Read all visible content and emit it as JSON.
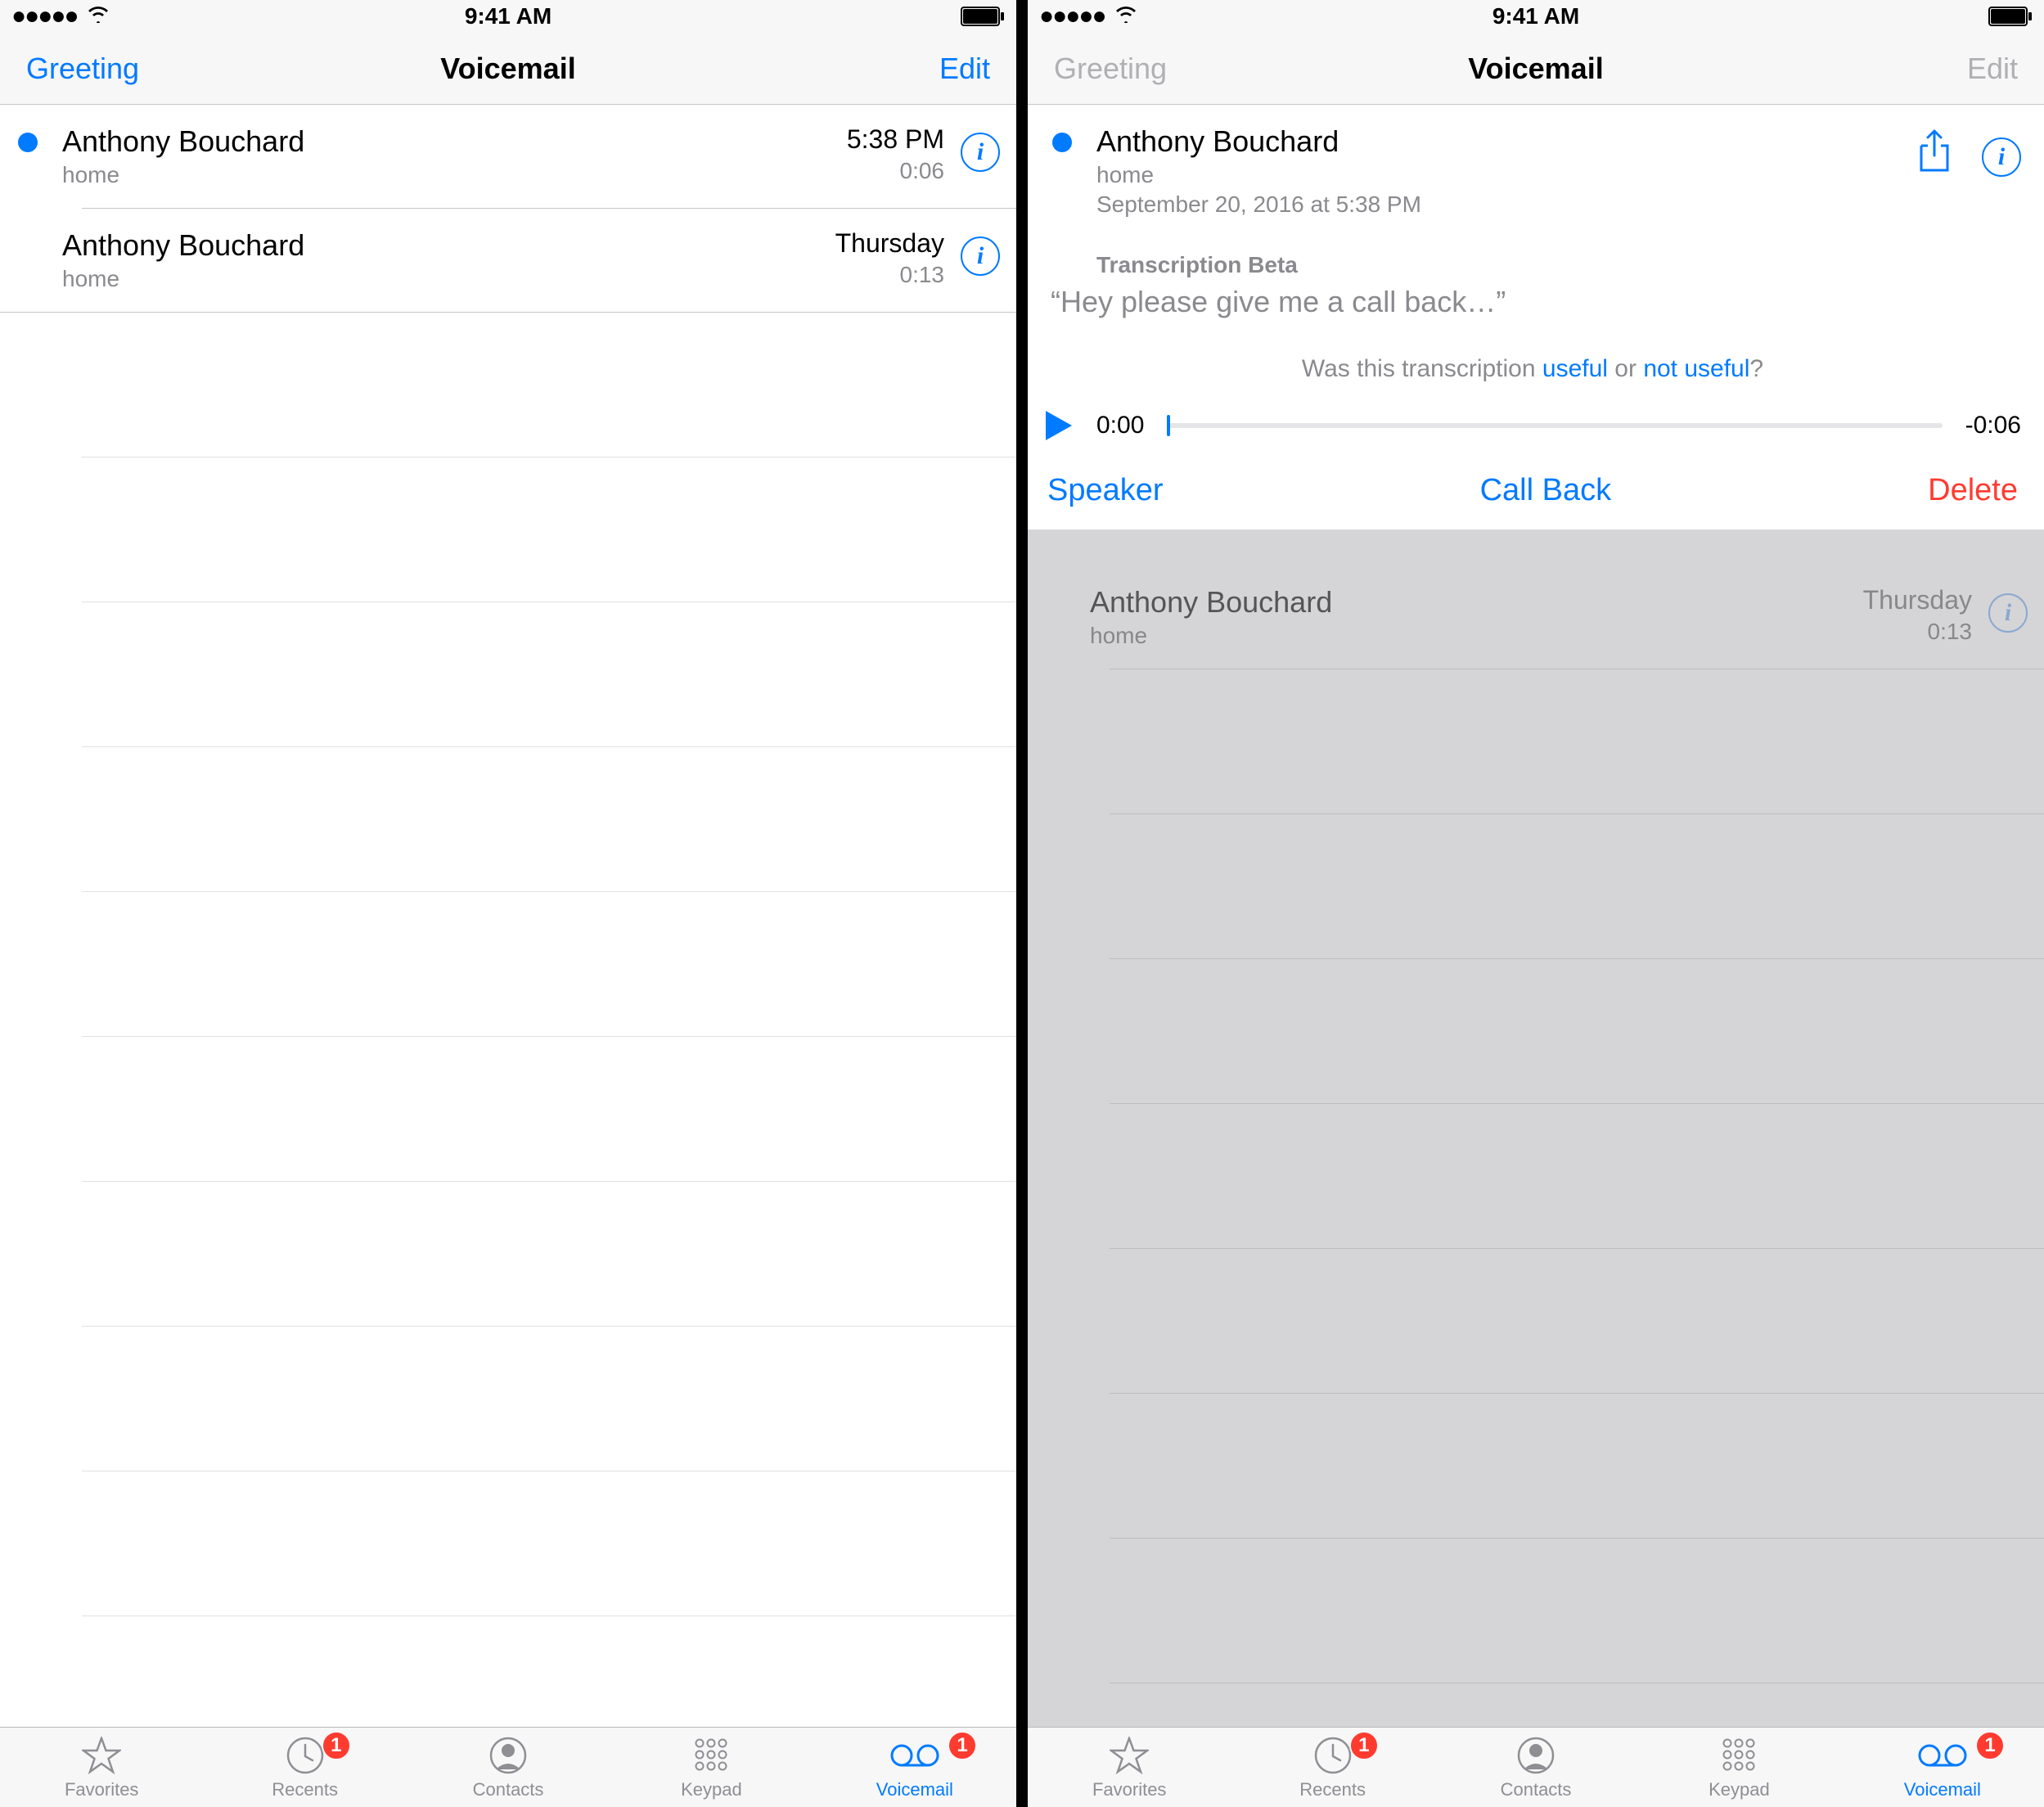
{
  "status": {
    "time": "9:41 AM"
  },
  "nav": {
    "greeting": "Greeting",
    "title": "Voicemail",
    "edit": "Edit"
  },
  "left": {
    "voicemails": [
      {
        "unread": true,
        "name": "Anthony Bouchard",
        "label": "home",
        "time": "5:38 PM",
        "duration": "0:06"
      },
      {
        "unread": false,
        "name": "Anthony Bouchard",
        "label": "home",
        "time": "Thursday",
        "duration": "0:13"
      }
    ]
  },
  "right": {
    "expanded": {
      "unread": true,
      "name": "Anthony Bouchard",
      "label": "home",
      "date": "September 20, 2016 at 5:38 PM",
      "transcription_title": "Transcription Beta",
      "transcription_text": "“Hey please give me a call back…”",
      "feedback_prefix": "Was this transcription ",
      "feedback_useful": "useful",
      "feedback_or": " or ",
      "feedback_not_useful": "not useful",
      "feedback_suffix": "?",
      "elapsed": "0:00",
      "remaining": "-0:06",
      "speaker": "Speaker",
      "call_back": "Call Back",
      "delete": "Delete"
    },
    "other": {
      "name": "Anthony Bouchard",
      "label": "home",
      "time": "Thursday",
      "duration": "0:13"
    }
  },
  "tabs": {
    "favorites": "Favorites",
    "recents": "Recents",
    "contacts": "Contacts",
    "keypad": "Keypad",
    "voicemail": "Voicemail",
    "recents_badge": "1",
    "voicemail_badge": "1"
  }
}
